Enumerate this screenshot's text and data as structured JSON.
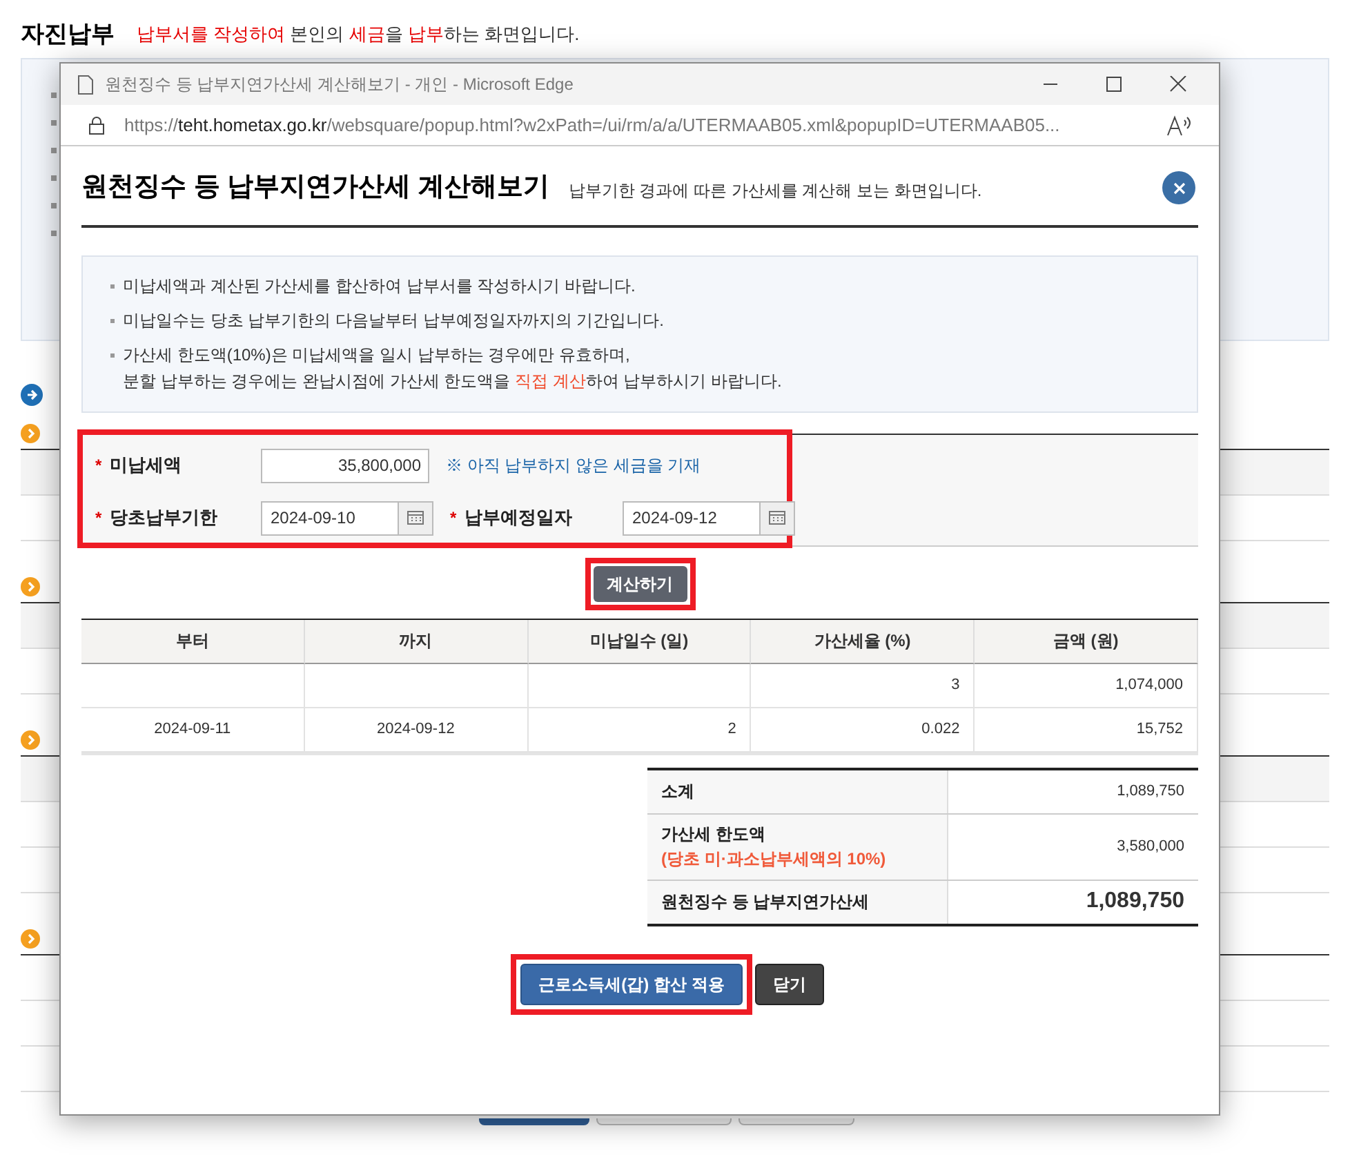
{
  "page": {
    "title": "자진납부",
    "subtitle": [
      {
        "text": "납부서를 작성하여",
        "highlight": true
      },
      {
        "text": " 본인의 ",
        "highlight": false
      },
      {
        "text": "세금",
        "highlight": true
      },
      {
        "text": "을 ",
        "highlight": false
      },
      {
        "text": "납부",
        "highlight": true
      },
      {
        "text": "하는 화면입니다.",
        "highlight": false
      }
    ],
    "sections": [
      {
        "kind": "main"
      },
      {
        "kind": "sub",
        "rows": [
          {
            "kind": "header"
          },
          {
            "kind": "row"
          }
        ]
      },
      {
        "kind": "sub",
        "rows": [
          {
            "kind": "header"
          },
          {
            "kind": "row"
          }
        ]
      },
      {
        "kind": "sub",
        "rows": [
          {
            "kind": "header"
          },
          {
            "kind": "row"
          },
          {
            "kind": "row"
          }
        ]
      },
      {
        "kind": "sub",
        "rows": [
          {
            "kind": "row"
          },
          {
            "kind": "row"
          },
          {
            "kind": "row"
          }
        ]
      }
    ]
  },
  "browser": {
    "title": "원천징수 등 납부지연가산세 계산해보기 - 개인 - Microsoft Edge",
    "url": [
      {
        "text": "https://",
        "emphasis": false
      },
      {
        "text": "teht.hometax.go.kr",
        "emphasis": true
      },
      {
        "text": "/websquare/popup.html?w2xPath=/ui/rm/a/a/UTERMAAB05.xml&popupID=UTERMAAB05...",
        "emphasis": false
      }
    ]
  },
  "popup": {
    "title": "원천징수 등 납부지연가산세 계산해보기",
    "subtitle": "납부기한 경과에 따른 가산세를 계산해 보는 화면입니다.",
    "notes": [
      {
        "lines": [
          [
            {
              "text": "미납세액과 계산된 가산세를 합산하여 납부서를 작성하시기 바랍니다.",
              "highlight": false
            }
          ]
        ]
      },
      {
        "lines": [
          [
            {
              "text": "미납일수는 당초 납부기한의 다음날부터 납부예정일자까지의 기간입니다.",
              "highlight": false
            }
          ]
        ]
      },
      {
        "lines": [
          [
            {
              "text": "가산세 한도액(10%)은 미납세액을 일시 납부하는 경우에만 유효하며,",
              "highlight": false
            }
          ],
          [
            {
              "text": "분할 납부하는 경우에는 완납시점에 가산세 한도액을 ",
              "highlight": false
            },
            {
              "text": "직접 계산",
              "highlight": true
            },
            {
              "text": "하여 납부하시기 바랍니다.",
              "highlight": false
            }
          ]
        ]
      }
    ],
    "form": {
      "highlighted": true,
      "unpaid_tax": {
        "label": "미납세액",
        "marker": "*",
        "value": "35,800,000",
        "hint": "※ 아직 납부하지 않은 세금을 기재"
      },
      "due_date": {
        "label": "당초납부기한",
        "marker": "*",
        "value": "2024-09-10"
      },
      "payment_date": {
        "label": "납부예정일자",
        "marker": "*",
        "value": "2024-09-12"
      }
    },
    "calculate_button": {
      "label": "계산하기",
      "highlighted": true
    },
    "table": {
      "columns": [
        "부터",
        "까지",
        "미납일수 (일)",
        "가산세율 (%)",
        "금액 (원)"
      ],
      "rows": [
        [
          "",
          "",
          "",
          "3",
          "1,074,000"
        ],
        [
          "2024-09-11",
          "2024-09-12",
          "2",
          "0.022",
          "15,752"
        ]
      ]
    },
    "summary": [
      {
        "kind": "normal",
        "label": "소계",
        "value": "1,089,750"
      },
      {
        "kind": "normal",
        "label": "가산세 한도액",
        "note": "(당초 미·과소납부세액의 10%)",
        "value": "3,580,000"
      },
      {
        "kind": "total",
        "label": "원천징수 등 납부지연가산세",
        "value": "1,089,750"
      }
    ],
    "buttons": [
      {
        "label": "근로소득세(갑) 합산 적용",
        "kind": "primary",
        "highlighted": true
      },
      {
        "label": "닫기",
        "kind": "dark",
        "highlighted": false
      }
    ]
  }
}
